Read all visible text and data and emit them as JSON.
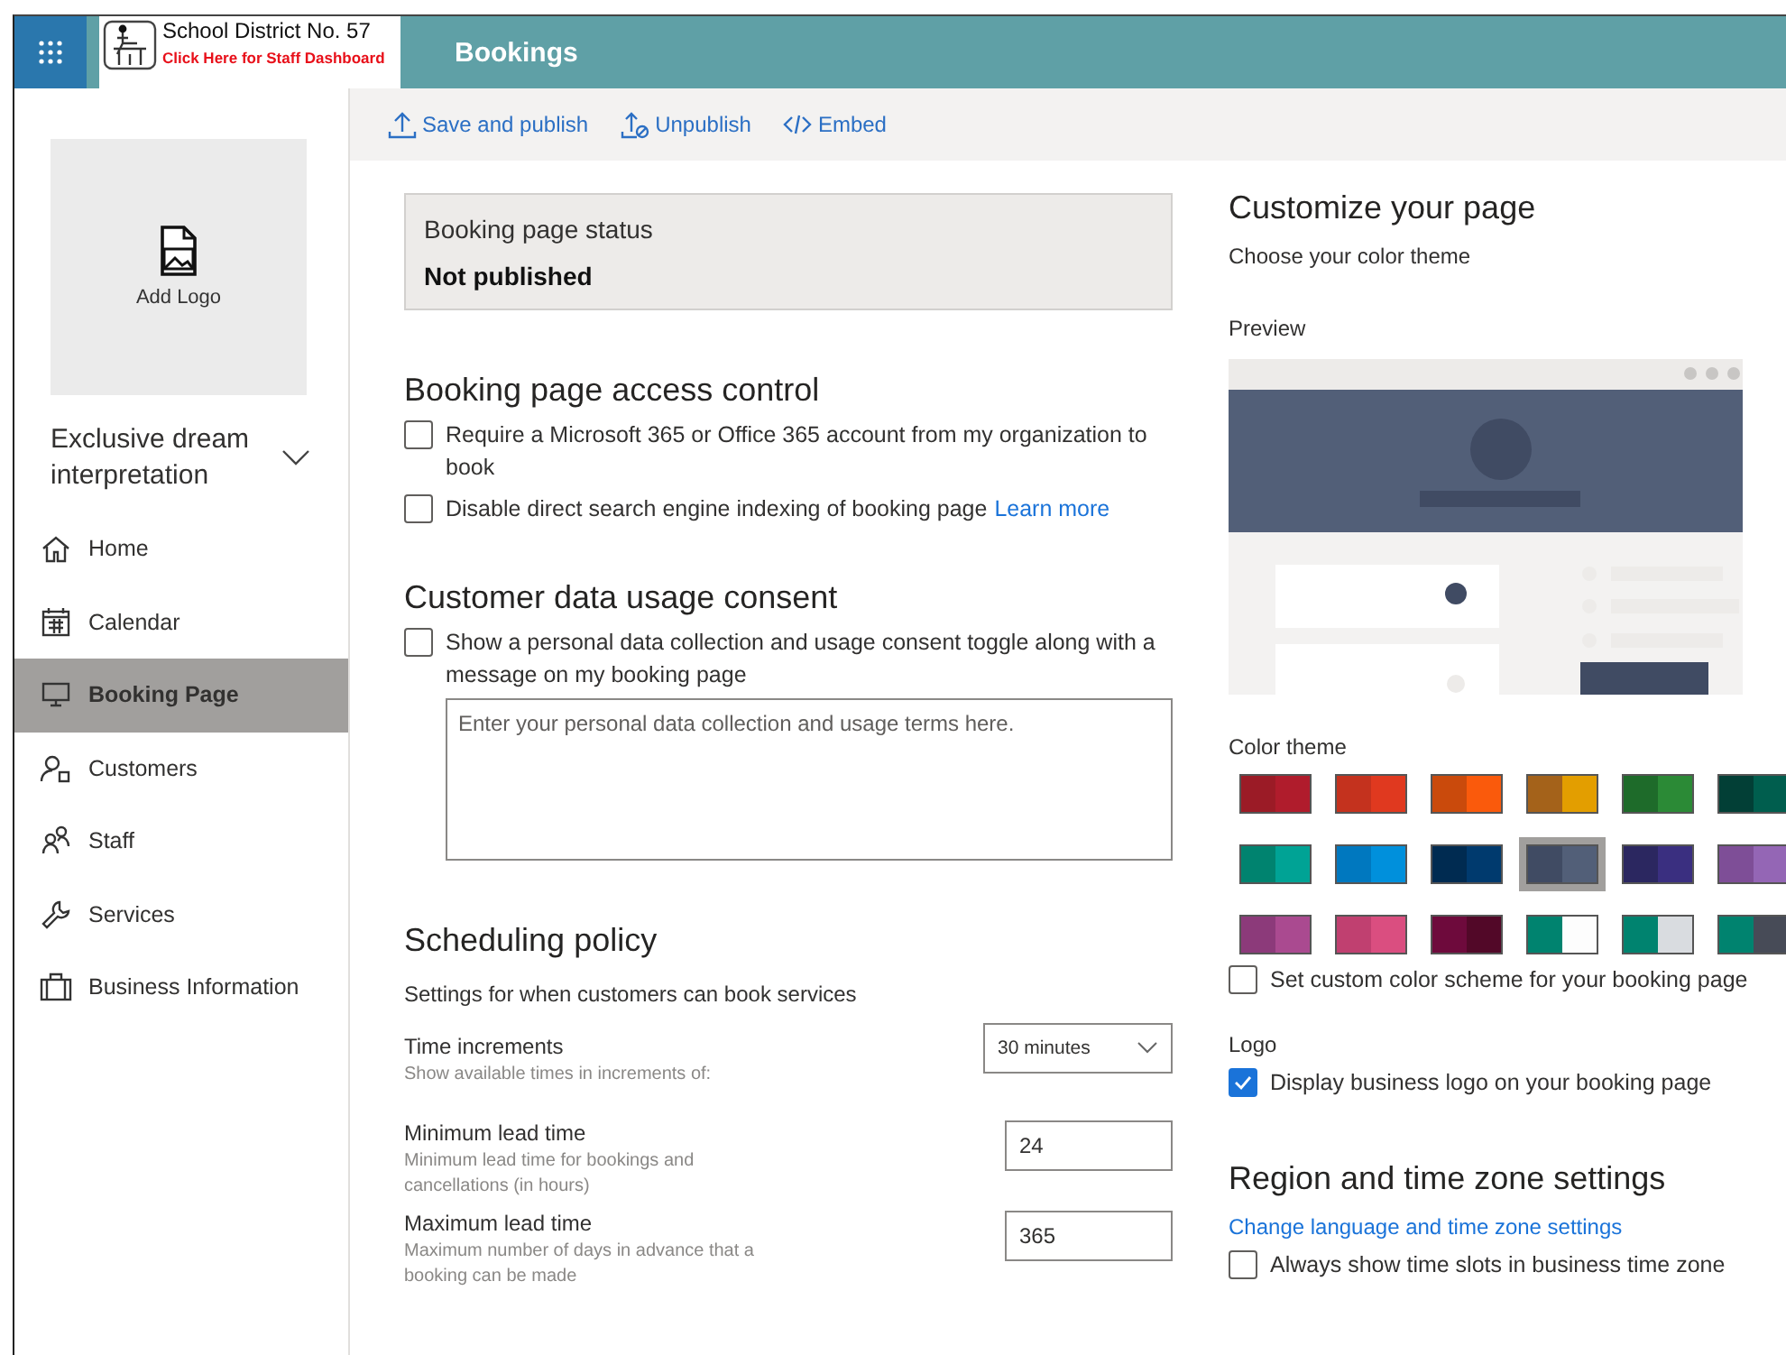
{
  "app_bar": {
    "org_name": "School District No. 57",
    "staff_link": "Click Here for Staff Dashboard",
    "title": "Bookings"
  },
  "sidebar": {
    "logo_label": "Add Logo",
    "business_name": "Exclusive dream interpretation",
    "items": [
      {
        "label": "Home",
        "selected": false
      },
      {
        "label": "Calendar",
        "selected": false
      },
      {
        "label": "Booking Page",
        "selected": true
      },
      {
        "label": "Customers",
        "selected": false
      },
      {
        "label": "Staff",
        "selected": false
      },
      {
        "label": "Services",
        "selected": false
      },
      {
        "label": "Business Information",
        "selected": false
      }
    ]
  },
  "toolbar": [
    {
      "label": "Save and publish"
    },
    {
      "label": "Unpublish"
    },
    {
      "label": "Embed"
    }
  ],
  "status": {
    "title": "Booking page status",
    "value": "Not published"
  },
  "access_control": {
    "heading": "Booking page access control",
    "options": [
      {
        "label": "Require a Microsoft 365 or Office 365 account from my organization to book",
        "checked": false
      },
      {
        "label": "Disable direct search engine indexing of booking page",
        "link": "Learn more",
        "checked": false
      }
    ]
  },
  "consent": {
    "heading": "Customer data usage consent",
    "option": {
      "label": "Show a personal data collection and usage consent toggle along with a message on my booking page",
      "checked": false
    },
    "terms_placeholder": "Enter your personal data collection and usage terms here."
  },
  "scheduling": {
    "heading": "Scheduling policy",
    "description": "Settings for when customers can book services",
    "settings": [
      {
        "kind": "dropdown",
        "label": "Time increments",
        "hint": "Show available times in increments of:",
        "value": "30 minutes"
      },
      {
        "kind": "number",
        "label": "Minimum lead time",
        "hint": "Minimum lead time for bookings and cancellations (in hours)",
        "value": "24"
      },
      {
        "kind": "number",
        "label": "Maximum lead time",
        "hint": "Maximum number of days in advance that a booking can be made",
        "value": "365"
      }
    ]
  },
  "customize": {
    "heading": "Customize your page",
    "subheading": "Choose your color theme",
    "preview_label": "Preview",
    "color_theme_label": "Color theme",
    "swatches": [
      {
        "halves": [
          {
            "color": "#9b1b26"
          },
          {
            "color": "#b01c2c"
          }
        ],
        "selected": false
      },
      {
        "halves": [
          {
            "color": "#c4321e"
          },
          {
            "color": "#e0391f"
          }
        ],
        "selected": false
      },
      {
        "halves": [
          {
            "color": "#ca4a0c"
          },
          {
            "color": "#fa5a0c"
          }
        ],
        "selected": false
      },
      {
        "halves": [
          {
            "color": "#a4621a"
          },
          {
            "color": "#e39e00"
          }
        ],
        "selected": false
      },
      {
        "halves": [
          {
            "color": "#1e6b2a"
          },
          {
            "color": "#2b8a36"
          }
        ],
        "selected": false
      },
      {
        "halves": [
          {
            "color": "#023f36"
          },
          {
            "color": "#005e4e"
          }
        ],
        "selected": false
      },
      {
        "halves": [
          {
            "color": "#00836f"
          },
          {
            "color": "#00a395"
          }
        ],
        "selected": false
      },
      {
        "halves": [
          {
            "color": "#0078bf"
          },
          {
            "color": "#0090dc"
          }
        ],
        "selected": false
      },
      {
        "halves": [
          {
            "color": "#002b51"
          },
          {
            "color": "#003a6e"
          }
        ],
        "selected": false
      },
      {
        "halves": [
          {
            "color": "#404b63"
          },
          {
            "color": "#525f78"
          }
        ],
        "selected": true
      },
      {
        "halves": [
          {
            "color": "#2b2760"
          },
          {
            "color": "#3a2f80"
          }
        ],
        "selected": false
      },
      {
        "halves": [
          {
            "color": "#7e4e97"
          },
          {
            "color": "#9466b5"
          }
        ],
        "selected": false
      },
      {
        "halves": [
          {
            "color": "#8c3a7a"
          },
          {
            "color": "#aa4a90"
          }
        ],
        "selected": false
      },
      {
        "halves": [
          {
            "color": "#c04070"
          },
          {
            "color": "#da4e80"
          }
        ],
        "selected": false
      },
      {
        "halves": [
          {
            "color": "#6e0a3c"
          },
          {
            "color": "#520828"
          }
        ],
        "selected": false
      },
      {
        "halves": [
          {
            "color": "#00836f"
          },
          {
            "color": "#fdfdfd"
          }
        ],
        "selected": false
      },
      {
        "halves": [
          {
            "color": "#00836f"
          },
          {
            "color": "#d9dce0"
          }
        ],
        "selected": false
      },
      {
        "halves": [
          {
            "color": "#00836f"
          },
          {
            "color": "#474b57"
          }
        ],
        "selected": false
      }
    ],
    "custom_scheme": {
      "label": "Set custom color scheme for your booking page",
      "checked": false
    },
    "logo_label": "Logo",
    "logo_option": {
      "label": "Display business logo on your booking page",
      "checked": true
    }
  },
  "region": {
    "heading": "Region and time zone settings",
    "link": "Change language and time zone settings",
    "option": {
      "label": "Always show time slots in business time zone",
      "checked": false
    }
  }
}
